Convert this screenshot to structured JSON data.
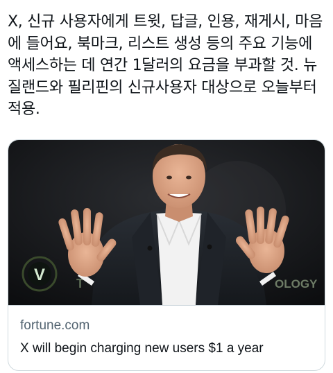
{
  "tweet": {
    "text": "X, 신규 사용자에게 트윗, 답글, 인용, 재게시, 마음에 들어요, 북마크, 리스트 생성 등의 주요 기능에 액세스하는 데 연간 1달러의 요금을 부과할 것. 뉴질랜드와 필리핀의 신규사용자 대상으로 오늘부터 적용."
  },
  "link_card": {
    "domain": "fortune.com",
    "title": "X will begin charging new users $1 a year",
    "image": {
      "logo_letter": "V",
      "background_text_left": "T",
      "background_text_right": "OLOGY",
      "accent_color": "#c8f04a"
    }
  }
}
